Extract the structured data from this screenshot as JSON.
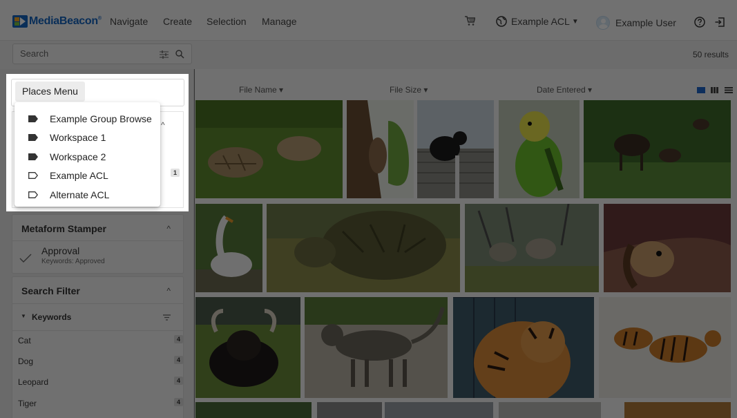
{
  "app": {
    "logo_text": "MediaBeacon",
    "logo_mark": "®"
  },
  "nav": [
    "Navigate",
    "Create",
    "Selection",
    "Manage"
  ],
  "topright": {
    "acl_label": "Example ACL",
    "user_label": "Example User"
  },
  "search": {
    "placeholder": "Search",
    "results": "50 results"
  },
  "sidebar": {
    "places_menu_label": "Places Menu",
    "behind_badge": "1",
    "metaform": {
      "title": "Metaform Stamper",
      "item_title": "Approval",
      "item_sub": "Keywords: Approved"
    },
    "search_filter": {
      "title": "Search Filter",
      "keywords_label": "Keywords",
      "items": [
        {
          "label": "Cat",
          "count": "4"
        },
        {
          "label": "Dog",
          "count": "4"
        },
        {
          "label": "Leopard",
          "count": "4"
        },
        {
          "label": "Tiger",
          "count": "4"
        }
      ]
    }
  },
  "columns": {
    "file_name": "File Name",
    "file_size": "File Size",
    "date_entered": "Date Entered"
  },
  "places_menu": [
    {
      "label": "Example Group Browse",
      "icon": "tag-filled-icon"
    },
    {
      "label": "Workspace 1",
      "icon": "tag-filled-icon"
    },
    {
      "label": "Workspace 2",
      "icon": "tag-filled-icon"
    },
    {
      "label": "Example ACL",
      "icon": "tag-outline-icon"
    },
    {
      "label": "Alternate ACL",
      "icon": "tag-outline-icon"
    }
  ],
  "thumbnails": [
    "tortoises-on-grass",
    "squirrel-on-tree",
    "black-cat-on-post",
    "green-parakeet",
    "moose-in-forest",
    "white-goose",
    "large-tortoise",
    "wolves-on-rocks",
    "dog-under-blanket",
    "yak-lying-down",
    "tabby-cat-walking",
    "tiger-portrait",
    "tigers-in-snow",
    "partial-thumbnail-1",
    "partial-thumbnail-2",
    "partial-thumbnail-3",
    "partial-thumbnail-4",
    "partial-thumbnail-5"
  ],
  "colors": {
    "brand": "#1565c0",
    "view_active": "#1e64c8"
  }
}
